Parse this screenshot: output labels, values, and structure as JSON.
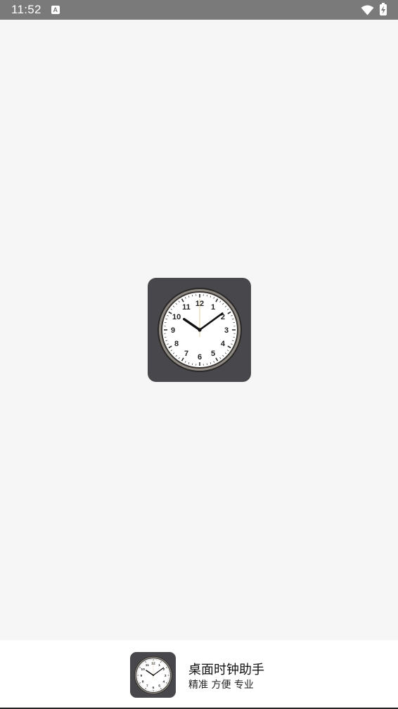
{
  "status_bar": {
    "time": "11:52",
    "notification_letter": "A",
    "icons": [
      "wifi-icon",
      "battery-charging-icon"
    ]
  },
  "splash": {
    "logo_icon": "analog-clock-icon",
    "clock": {
      "hour_numerals": [
        "12",
        "1",
        "2",
        "3",
        "4",
        "5",
        "6",
        "7",
        "8",
        "9",
        "10",
        "11"
      ],
      "hours": 10,
      "minutes": 9,
      "seconds": 0
    }
  },
  "bottom_bar": {
    "app_name": "桌面时钟助手",
    "tagline": "精准 方便 专业"
  },
  "colors": {
    "status_bar_bg": "#7a7a7a",
    "background": "#f6f6f6",
    "icon_tile": "#48484c",
    "clock_face": "#ffffff"
  }
}
